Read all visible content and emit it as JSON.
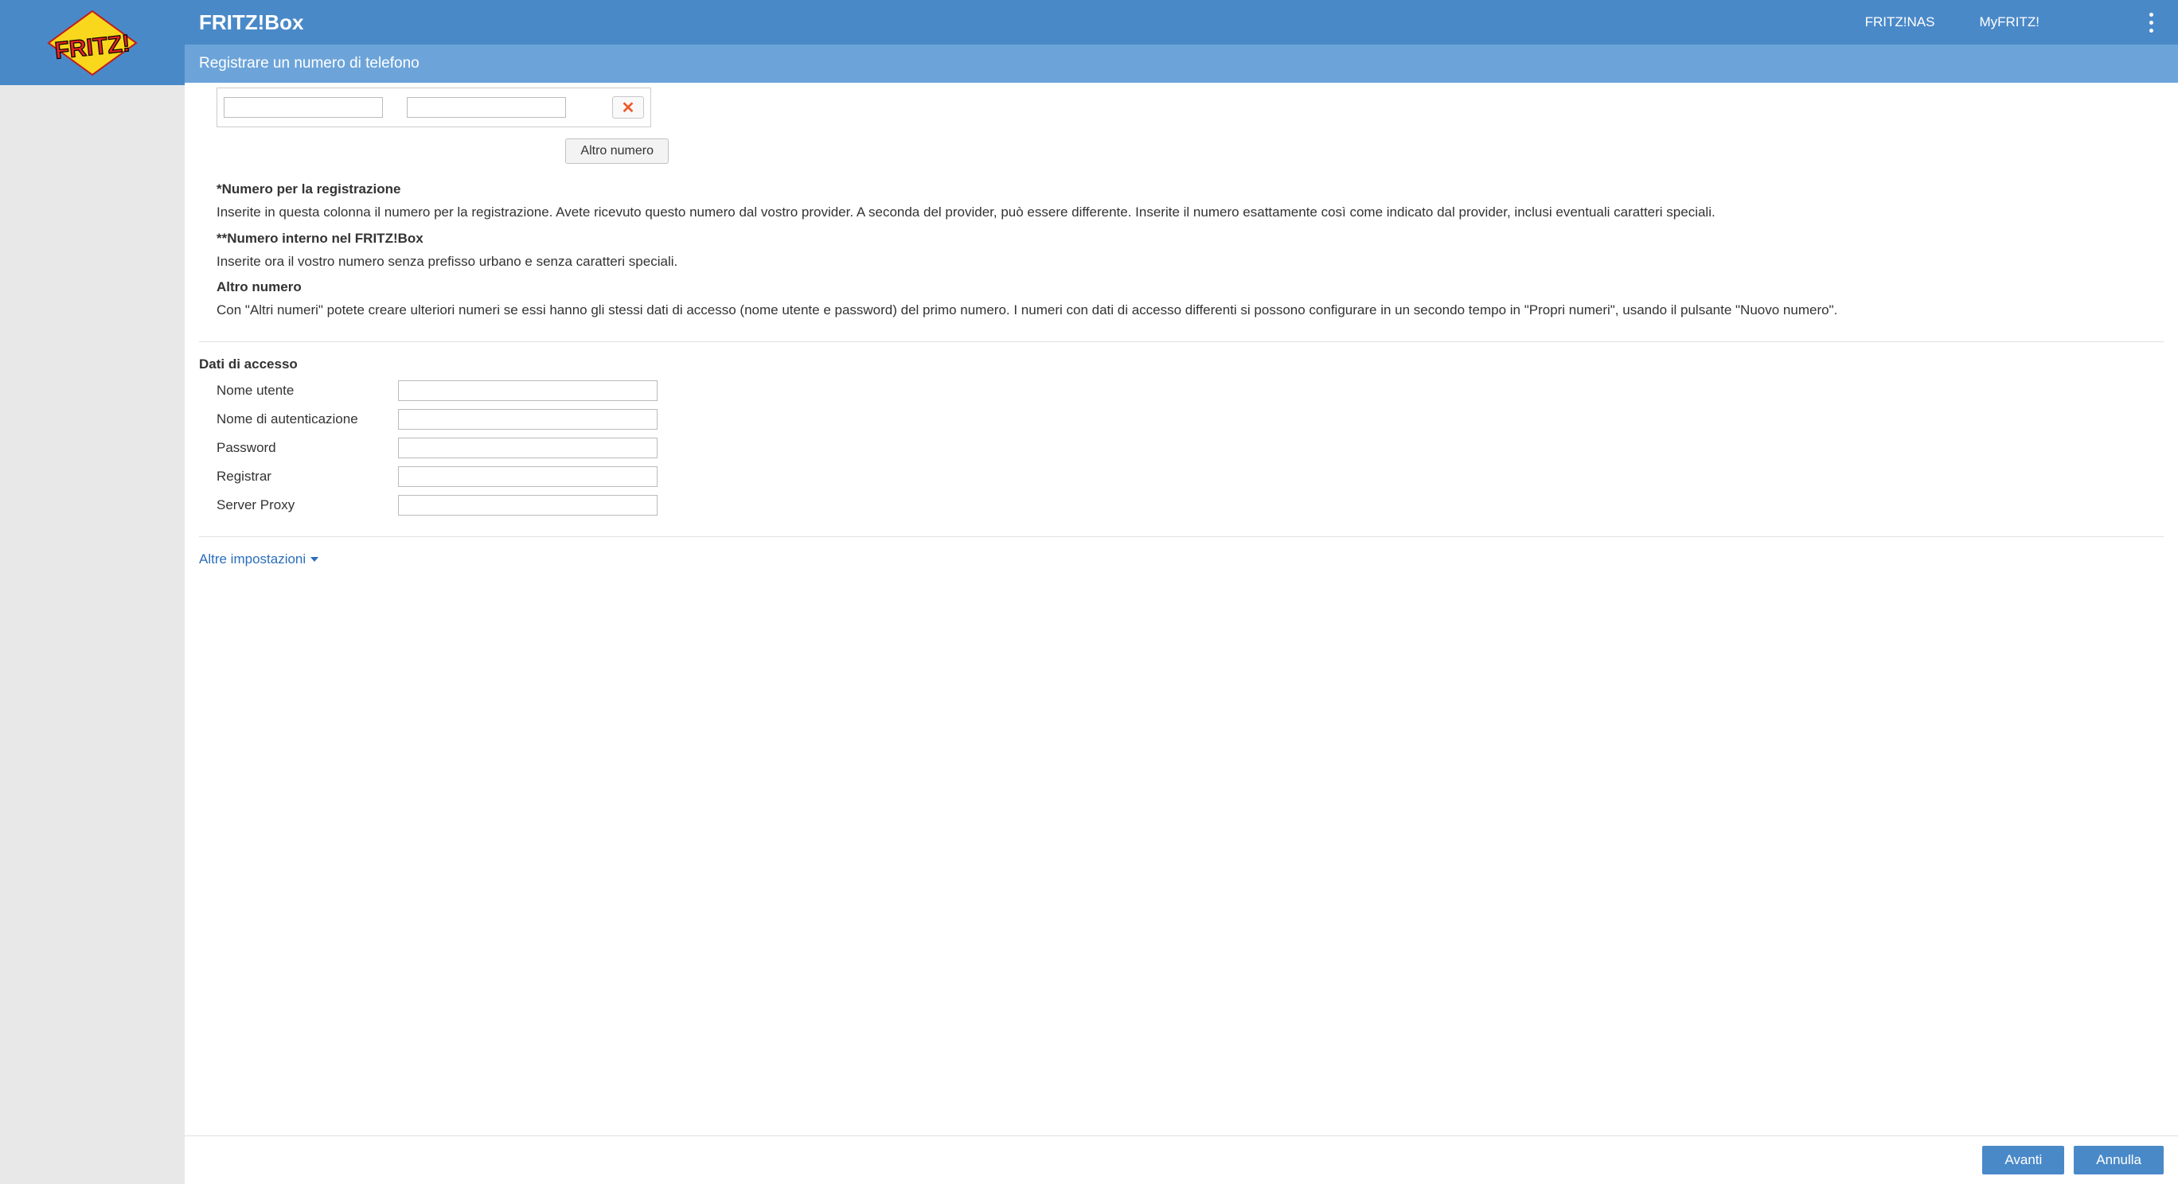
{
  "header": {
    "title": "FRITZ!Box",
    "nav1": "FRITZ!NAS",
    "nav2": "MyFRITZ!"
  },
  "subheader": "Registrare un numero di telefono",
  "add_number_btn": "Altro numero",
  "help": {
    "t1": "*Numero per la registrazione",
    "p1": "Inserite in questa colonna il numero per la registrazione. Avete ricevuto questo numero dal vostro provider. A seconda del provider, può essere differente. Inserite il numero esattamente così come indicato dal provider, inclusi eventuali caratteri speciali.",
    "t2": "**Numero interno nel FRITZ!Box",
    "p2": "Inserite ora il vostro numero senza prefisso urbano e senza caratteri speciali.",
    "t3": "Altro numero",
    "p3": "Con \"Altri numeri\" potete creare ulteriori numeri se essi hanno gli stessi dati di accesso (nome utente e password) del primo numero. I numeri con dati di accesso differenti si possono configurare in un secondo tempo in \"Propri numeri\", usando il pulsante \"Nuovo numero\"."
  },
  "access": {
    "section_title": "Dati di accesso",
    "username_label": "Nome utente",
    "authname_label": "Nome di autenticazione",
    "password_label": "Password",
    "registrar_label": "Registrar",
    "proxy_label": "Server Proxy"
  },
  "more_settings": "Altre impostazioni",
  "footer": {
    "next": "Avanti",
    "cancel": "Annulla"
  }
}
